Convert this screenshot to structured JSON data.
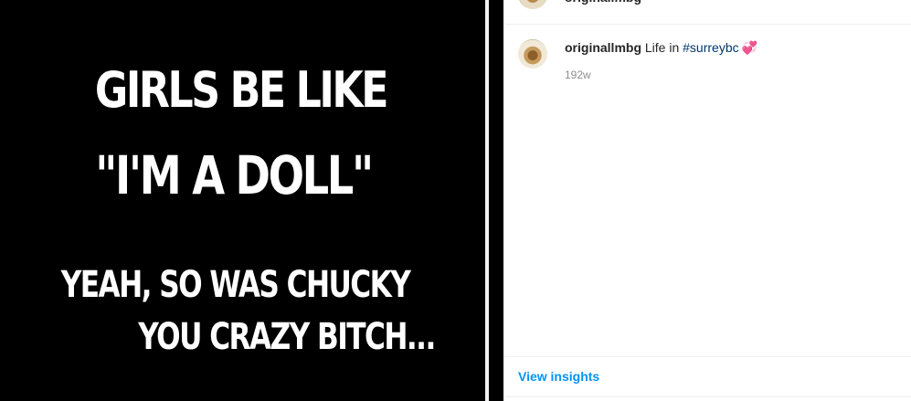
{
  "post_image": {
    "lines": [
      "GIRLS BE LIKE",
      "\"I'M A DOLL\"",
      "YEAH, SO WAS CHUCKY",
      "YOU CRAZY BITCH..."
    ]
  },
  "header": {
    "username": "originallmbg"
  },
  "caption": {
    "username": "originallmbg",
    "text": " Life in ",
    "hashtag": "#surreybc",
    "emoji": "💞",
    "timestamp": "192w"
  },
  "footer": {
    "insights_label": "View insights"
  },
  "colors": {
    "link": "#0095f6",
    "hashtag": "#00376b",
    "muted": "#8e8e8e"
  }
}
